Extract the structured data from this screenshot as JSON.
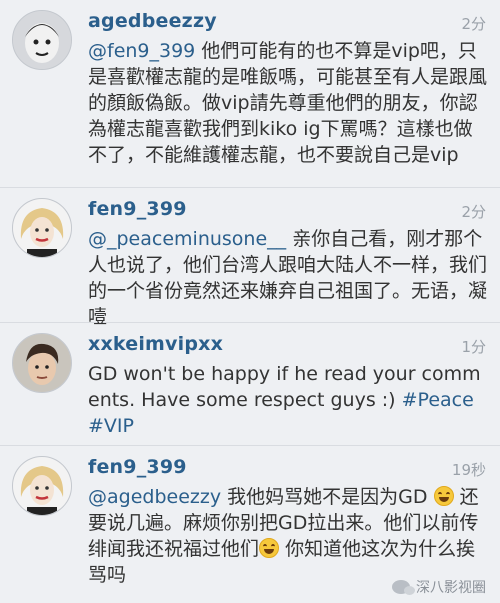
{
  "comments": [
    {
      "username": "agedbeezzy",
      "time": "2分",
      "mention": "@fen9_399",
      "text": " 他們可能有的也不算是vip吧，只是喜歡權志龍的是唯飯嗎，可能甚至有人是跟風的顏飯偽飯。做vip請先尊重他們的朋友，你認為權志龍喜歡我們到kiko ig下罵嗎？這樣也做不了，不能維護權志龍，也不要說自己是vip"
    },
    {
      "username": "fen9_399",
      "time": "2分",
      "mention": "@_peaceminusone__",
      "text": " 亲你自己看，刚才那个人也说了，他们台湾人跟咱大陆人不一样，我们的一个省份竟然还来嫌弃自己祖国了。无语，凝噎"
    },
    {
      "username": "xxkeimvipxx",
      "time": "1分",
      "text": "GD won't be happy if he read your comments. Have some respect guys :)",
      "tags": "#Peace #VIP"
    },
    {
      "username": "fen9_399",
      "time": "19秒",
      "mention": "@agedbeezzy",
      "text_a": " 我他妈骂她不是因为GD",
      "text_b": "还要说几遍。麻烦你别把GD拉出来。他们以前传绯闻我还祝福过他们",
      "text_c": "你知道他这次为什么挨骂吗"
    }
  ],
  "watermark": "深八影视圈"
}
